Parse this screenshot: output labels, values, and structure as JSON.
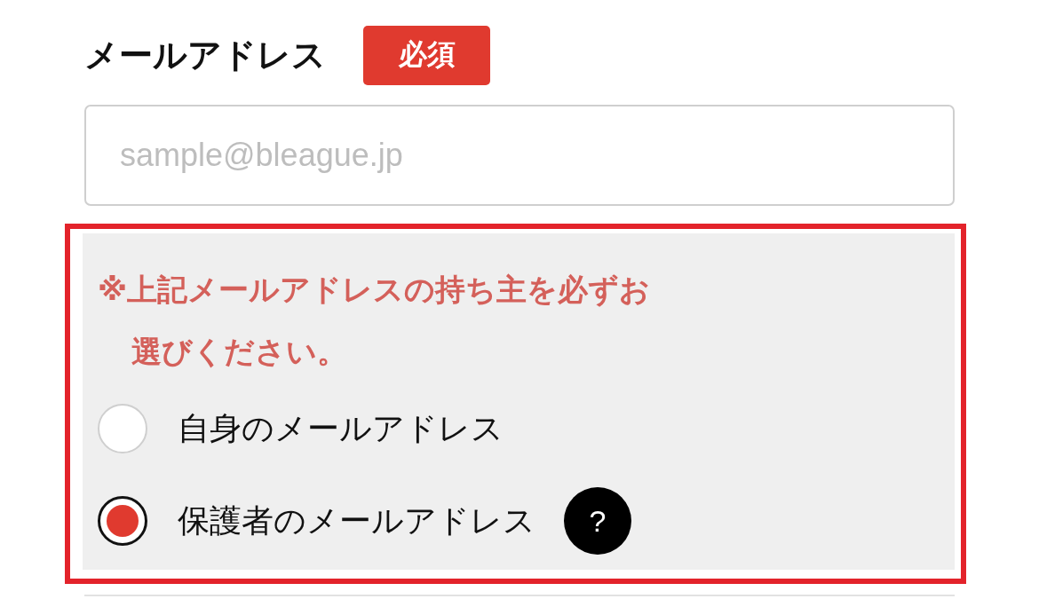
{
  "email_field": {
    "label": "メールアドレス",
    "badge": "必須",
    "placeholder": "sample@bleague.jp"
  },
  "owner_notice": {
    "text": "※上記メールアドレスの持ち主を必ずお選びください。",
    "options": [
      {
        "label": "自身のメールアドレス",
        "selected": false,
        "help": false
      },
      {
        "label": "保護者のメールアドレス",
        "selected": true,
        "help": true,
        "help_mark": "?"
      }
    ]
  }
}
